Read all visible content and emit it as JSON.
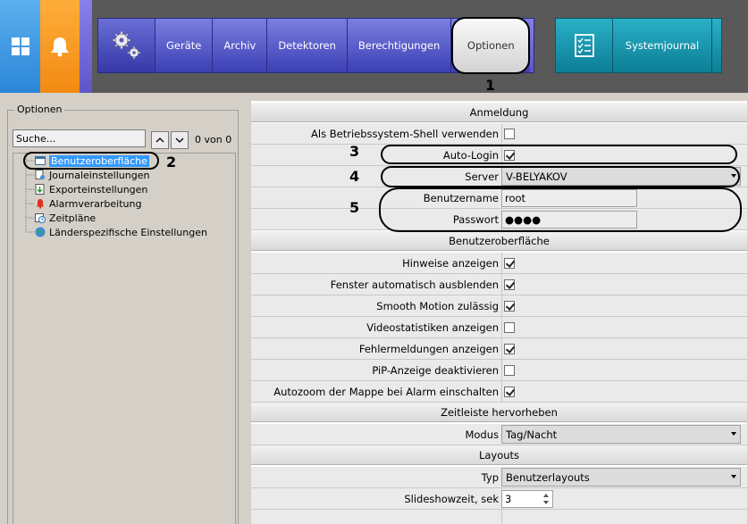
{
  "nav": {
    "tabs": [
      {
        "label": "Geräte"
      },
      {
        "label": "Archiv"
      },
      {
        "label": "Detektoren"
      },
      {
        "label": "Berechtigungen"
      },
      {
        "label": "Optionen",
        "active": true
      }
    ],
    "journal_label": "Systemjournal",
    "icons": {
      "windows": "windows-icon",
      "alarm": "bell-icon",
      "settings": "gears-icon",
      "journal": "checklist-icon"
    }
  },
  "callouts": [
    "1",
    "2",
    "3",
    "4",
    "5"
  ],
  "left": {
    "group_title": "Optionen",
    "search_value": "Suche...",
    "count_text": "0 von 0",
    "tree": [
      {
        "label": "Benutzeroberfläche",
        "icon": "window-icon",
        "selected": true
      },
      {
        "label": "Journaleinstellungen",
        "icon": "journal-settings-icon"
      },
      {
        "label": "Exporteinstellungen",
        "icon": "export-icon"
      },
      {
        "label": "Alarmverarbeitung",
        "icon": "alarm-icon"
      },
      {
        "label": "Zeitpläne",
        "icon": "schedule-icon"
      },
      {
        "label": "Länderspezifische Einstellungen",
        "icon": "globe-icon"
      }
    ]
  },
  "right": {
    "sections": {
      "login": "Anmeldung",
      "ui": "Benutzeroberfläche",
      "timeline": "Zeitleiste hervorheben",
      "layouts": "Layouts"
    },
    "login": {
      "shell_label": "Als Betriebssystem-Shell verwenden",
      "shell_checked": false,
      "autologin_label": "Auto-Login",
      "autologin_checked": true,
      "server_label": "Server",
      "server_value": "V-BELYAKOV",
      "username_label": "Benutzername",
      "username_value": "root",
      "password_label": "Passwort",
      "password_value": "●●●●"
    },
    "ui": [
      {
        "label": "Hinweise anzeigen",
        "checked": true
      },
      {
        "label": "Fenster automatisch ausblenden",
        "checked": true
      },
      {
        "label": "Smooth Motion zulässig",
        "checked": true
      },
      {
        "label": "Videostatistiken anzeigen",
        "checked": false
      },
      {
        "label": "Fehlermeldungen anzeigen",
        "checked": true
      },
      {
        "label": "PiP-Anzeige deaktivieren",
        "checked": false
      },
      {
        "label": "Autozoom der Mappe bei Alarm einschalten",
        "checked": true
      }
    ],
    "timeline": {
      "mode_label": "Modus",
      "mode_value": "Tag/Nacht"
    },
    "layouts": {
      "type_label": "Typ",
      "type_value": "Benutzerlayouts",
      "slideshow_label": "Slideshowzeit, sek",
      "slideshow_value": "3"
    }
  }
}
